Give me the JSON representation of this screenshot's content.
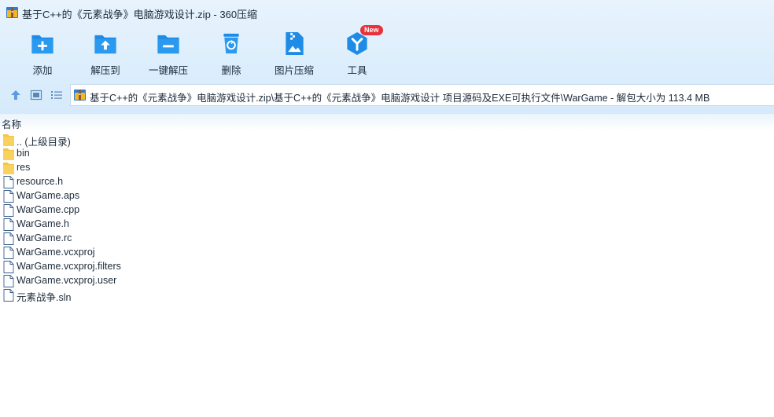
{
  "window": {
    "title": "基于C++的《元素战争》电脑游戏设计.zip - 360压缩"
  },
  "toolbar": {
    "items": [
      {
        "label": "添加",
        "icon": "add-folder-icon"
      },
      {
        "label": "解压到",
        "icon": "extract-to-icon"
      },
      {
        "label": "一键解压",
        "icon": "one-click-extract-icon"
      },
      {
        "label": "删除",
        "icon": "delete-icon"
      },
      {
        "label": "图片压缩",
        "icon": "image-compress-icon"
      },
      {
        "label": "工具",
        "icon": "tools-icon",
        "badge": "New"
      }
    ]
  },
  "address": {
    "path": "基于C++的《元素战争》电脑游戏设计.zip\\基于C++的《元素战争》电脑游戏设计 项目源码及EXE可执行文件\\WarGame - 解包大小为 113.4 MB"
  },
  "list": {
    "column_name": "名称",
    "files": [
      {
        "name": ".. (上级目录)",
        "type": "folder"
      },
      {
        "name": "bin",
        "type": "folder"
      },
      {
        "name": "res",
        "type": "folder"
      },
      {
        "name": "resource.h",
        "type": "file"
      },
      {
        "name": "WarGame.aps",
        "type": "file"
      },
      {
        "name": "WarGame.cpp",
        "type": "file"
      },
      {
        "name": "WarGame.h",
        "type": "file"
      },
      {
        "name": "WarGame.rc",
        "type": "file"
      },
      {
        "name": "WarGame.vcxproj",
        "type": "file"
      },
      {
        "name": "WarGame.vcxproj.filters",
        "type": "file"
      },
      {
        "name": "WarGame.vcxproj.user",
        "type": "file"
      },
      {
        "name": "元素战争.sln",
        "type": "file"
      }
    ]
  },
  "colors": {
    "accent": "#1e90e8",
    "folder": "#f5c542",
    "badge": "#e8313b"
  }
}
